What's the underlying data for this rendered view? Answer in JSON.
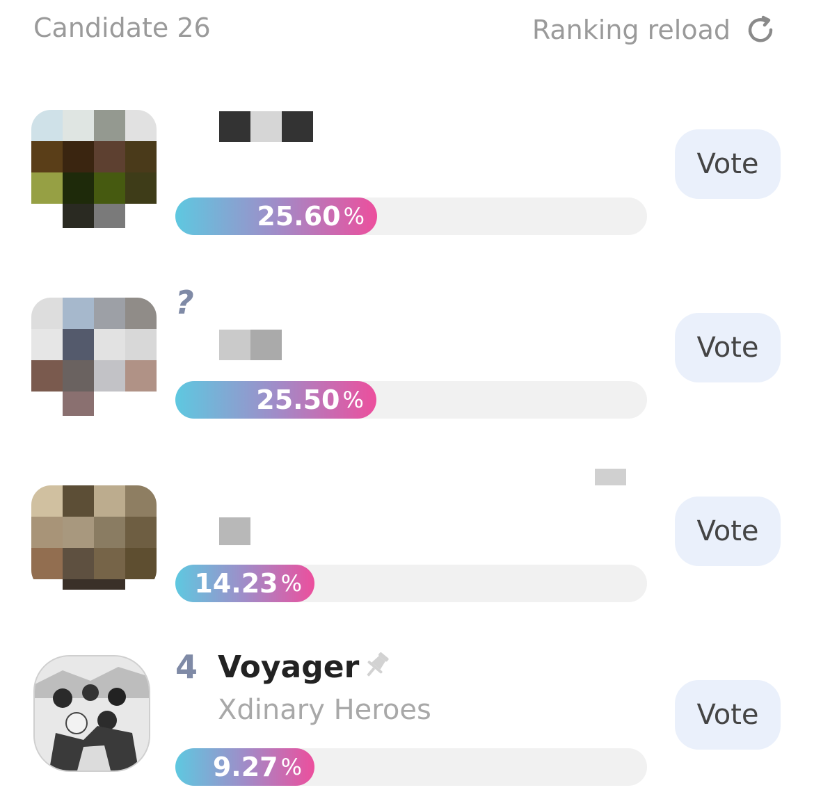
{
  "header": {
    "candidate_count": "Candidate 26",
    "reload_label": "Ranking reload",
    "reload_icon": "refresh-icon"
  },
  "candidates": [
    {
      "rank": "",
      "title": "",
      "subtitle": "",
      "percent_value": "25.60",
      "percent_sign": "%",
      "fraction": 0.256,
      "vote_label": "Vote",
      "avatar_colors": [
        "#cfe1e8",
        "#dfe5e2",
        "#949990",
        "#e1e1e1",
        "#5a3e18",
        "#3a2510",
        "#5d4030",
        "#4a3a1a",
        "#96a044",
        "#1e2a0a",
        "#465a10",
        "#3e3c18",
        "#ffffff",
        "#2a2a22",
        "#7a7a7a",
        "#ffffff"
      ]
    },
    {
      "rank": "?",
      "title": "",
      "subtitle": "",
      "percent_value": "25.50",
      "percent_sign": "%",
      "fraction": 0.255,
      "vote_label": "Vote",
      "avatar_colors": [
        "#dddddd",
        "#a6b8cc",
        "#9da0a6",
        "#908c88",
        "#e6e6e6",
        "#545a6c",
        "#e2e2e2",
        "#d8d8d8",
        "#7a5a4e",
        "#6a6260",
        "#c2c2c6",
        "#b09286",
        "#ffffff",
        "#8a7070",
        "#ffffff",
        "#ffffff"
      ]
    },
    {
      "rank": "",
      "title": "",
      "subtitle": "",
      "percent_value": "14.23",
      "percent_sign": "%",
      "fraction": 0.1423,
      "vote_label": "Vote",
      "avatar_colors": [
        "#d0c0a0",
        "#5c4e36",
        "#bcac8e",
        "#8e7e62",
        "#a89478",
        "#a8987e",
        "#8a7c62",
        "#6e5e42",
        "#926e50",
        "#5e5040",
        "#766448",
        "#5e4e30",
        "#ffffff",
        "#3a3028",
        "#3a3028",
        "#ffffff"
      ]
    },
    {
      "rank": "4",
      "title": "Voyager",
      "subtitle": "Xdinary Heroes",
      "percent_value": "9.27",
      "percent_sign": "%",
      "fraction": 0.0927,
      "vote_label": "Vote",
      "avatar_colors": []
    }
  ],
  "colors": {
    "bar_start": "#5ec8e0",
    "bar_end": "#ec4f9d",
    "button_bg": "#eaf0fb"
  }
}
